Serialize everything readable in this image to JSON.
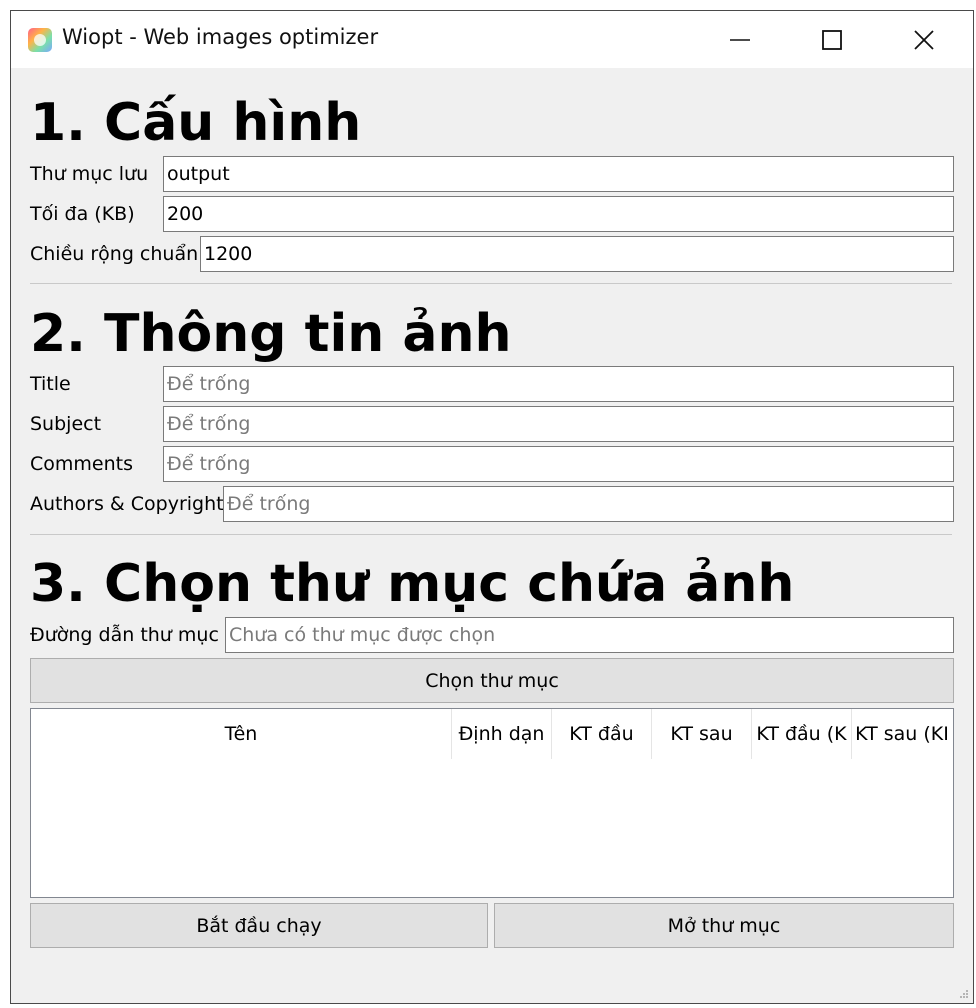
{
  "window": {
    "title": "Wiopt - Web images optimizer"
  },
  "icons": {
    "app": "app-icon",
    "minimize": "minimize-icon",
    "maximize": "maximize-icon",
    "close": "close-icon",
    "resize_grip": "resize-grip-icon"
  },
  "config": {
    "heading": "1. Cấu hình",
    "output_dir_label": "Thư mục lưu",
    "output_dir_value": "output",
    "max_size_label": "Tối đa (KB)",
    "max_size_value": "200",
    "width_label": "Chiều rộng chuẩn",
    "width_value": "1200"
  },
  "info": {
    "heading": "2. Thông tin ảnh",
    "title_label": "Title",
    "title_placeholder": "Để trống",
    "subject_label": "Subject",
    "subject_placeholder": "Để trống",
    "comments_label": "Comments",
    "comments_placeholder": "Để trống",
    "authors_label": "Authors & Copyright",
    "authors_placeholder": "Để trống"
  },
  "folder": {
    "heading": "3. Chọn thư mục chứa ảnh",
    "path_label": "Đường dẫn thư mục",
    "path_placeholder": "Chưa có thư mục được chọn",
    "choose_button": "Chọn thư mục"
  },
  "table": {
    "columns": [
      "Tên",
      "Định dạn",
      "KT đầu",
      "KT sau",
      "KT đầu (K",
      "KT sau (KI"
    ],
    "rows": []
  },
  "actions": {
    "start_button": "Bắt đầu chạy",
    "open_folder_button": "Mở thư mục"
  }
}
